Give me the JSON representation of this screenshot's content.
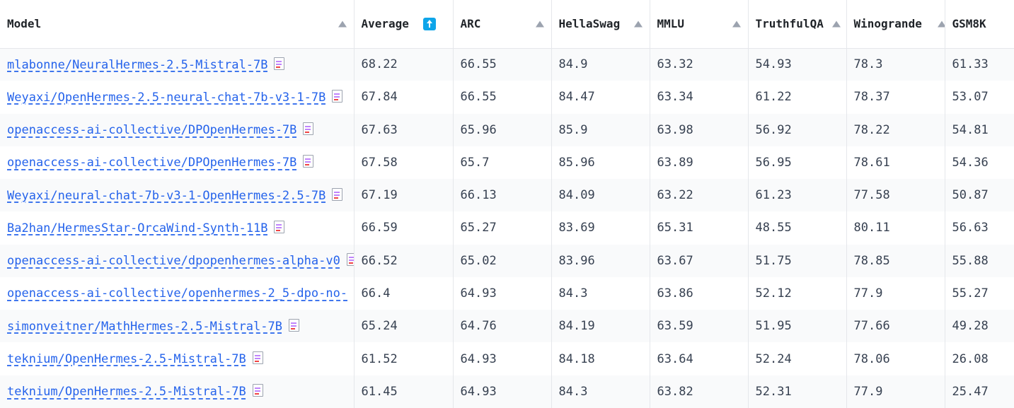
{
  "columns": [
    "Model",
    "Average",
    "ARC",
    "HellaSwag",
    "MMLU",
    "TruthfulQA",
    "Winogrande",
    "GSM8K"
  ],
  "rows": [
    {
      "model": "mlabonne/NeuralHermes-2.5-Mistral-7B",
      "average": "68.22",
      "arc": "66.55",
      "hellaswag": "84.9",
      "mmlu": "63.32",
      "truthfulqa": "54.93",
      "winogrande": "78.3",
      "gsm8k": "61.33"
    },
    {
      "model": "Weyaxi/OpenHermes-2.5-neural-chat-7b-v3-1-7B",
      "average": "67.84",
      "arc": "66.55",
      "hellaswag": "84.47",
      "mmlu": "63.34",
      "truthfulqa": "61.22",
      "winogrande": "78.37",
      "gsm8k": "53.07"
    },
    {
      "model": "openaccess-ai-collective/DPOpenHermes-7B",
      "average": "67.63",
      "arc": "65.96",
      "hellaswag": "85.9",
      "mmlu": "63.98",
      "truthfulqa": "56.92",
      "winogrande": "78.22",
      "gsm8k": "54.81"
    },
    {
      "model": "openaccess-ai-collective/DPOpenHermes-7B",
      "average": "67.58",
      "arc": "65.7",
      "hellaswag": "85.96",
      "mmlu": "63.89",
      "truthfulqa": "56.95",
      "winogrande": "78.61",
      "gsm8k": "54.36"
    },
    {
      "model": "Weyaxi/neural-chat-7b-v3-1-OpenHermes-2.5-7B",
      "average": "67.19",
      "arc": "66.13",
      "hellaswag": "84.09",
      "mmlu": "63.22",
      "truthfulqa": "61.23",
      "winogrande": "77.58",
      "gsm8k": "50.87"
    },
    {
      "model": "Ba2han/HermesStar-OrcaWind-Synth-11B",
      "average": "66.59",
      "arc": "65.27",
      "hellaswag": "83.69",
      "mmlu": "65.31",
      "truthfulqa": "48.55",
      "winogrande": "80.11",
      "gsm8k": "56.63"
    },
    {
      "model": "openaccess-ai-collective/dpopenhermes-alpha-v0",
      "average": "66.52",
      "arc": "65.02",
      "hellaswag": "83.96",
      "mmlu": "63.67",
      "truthfulqa": "51.75",
      "winogrande": "78.85",
      "gsm8k": "55.88"
    },
    {
      "model": "openaccess-ai-collective/openhermes-2_5-dpo-no-",
      "average": "66.4",
      "arc": "64.93",
      "hellaswag": "84.3",
      "mmlu": "63.86",
      "truthfulqa": "52.12",
      "winogrande": "77.9",
      "gsm8k": "55.27"
    },
    {
      "model": "simonveitner/MathHermes-2.5-Mistral-7B",
      "average": "65.24",
      "arc": "64.76",
      "hellaswag": "84.19",
      "mmlu": "63.59",
      "truthfulqa": "51.95",
      "winogrande": "77.66",
      "gsm8k": "49.28"
    },
    {
      "model": "teknium/OpenHermes-2.5-Mistral-7B",
      "average": "61.52",
      "arc": "64.93",
      "hellaswag": "84.18",
      "mmlu": "63.64",
      "truthfulqa": "52.24",
      "winogrande": "78.06",
      "gsm8k": "26.08"
    },
    {
      "model": "teknium/OpenHermes-2.5-Mistral-7B",
      "average": "61.45",
      "arc": "64.93",
      "hellaswag": "84.3",
      "mmlu": "63.82",
      "truthfulqa": "52.31",
      "winogrande": "77.9",
      "gsm8k": "25.47"
    }
  ],
  "icons": {
    "sort": "sort-ascending-icon",
    "active_sort": "sort-active-icon",
    "model_card": "document-icon"
  },
  "colors": {
    "link": "#2563eb",
    "active_sort": "#0ea5e9",
    "stripe": "#f9fafb"
  }
}
